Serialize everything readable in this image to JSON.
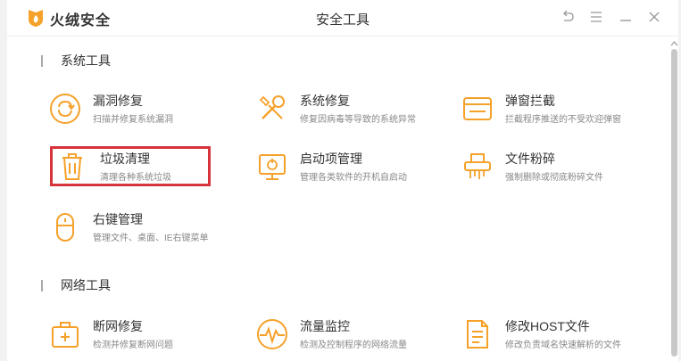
{
  "app": {
    "name": "火绒安全",
    "window_title": "安全工具"
  },
  "colors": {
    "accent": "#f5a12a",
    "highlight": "#d6343a"
  },
  "sections": [
    {
      "title": "系统工具",
      "tools": [
        {
          "name": "漏洞修复",
          "desc": "扫描并修复系统漏洞",
          "icon": "refresh-circle-icon"
        },
        {
          "name": "系统修复",
          "desc": "修复因病毒等导致的系统异常",
          "icon": "wrench-screwdriver-icon"
        },
        {
          "name": "弹窗拦截",
          "desc": "拦截程序推送的不受欢迎弹窗",
          "icon": "popup-window-icon"
        },
        {
          "name": "垃圾清理",
          "desc": "清理各种系统垃圾",
          "icon": "trash-icon"
        },
        {
          "name": "启动项管理",
          "desc": "管理各类软件的开机自启动",
          "icon": "monitor-power-icon"
        },
        {
          "name": "文件粉碎",
          "desc": "强制删除或彻底粉碎文件",
          "icon": "shredder-icon"
        },
        {
          "name": "右键管理",
          "desc": "管理文件、桌面、IE右键菜单",
          "icon": "mouse-icon"
        }
      ]
    },
    {
      "title": "网络工具",
      "tools": [
        {
          "name": "断网修复",
          "desc": "检测并修复断网问题",
          "icon": "first-aid-kit-icon"
        },
        {
          "name": "流量监控",
          "desc": "检测及控制程序的网络流量",
          "icon": "pulse-monitor-icon"
        },
        {
          "name": "修改HOST文件",
          "desc": "修改负责域名快速解析的文件",
          "icon": "document-icon"
        }
      ]
    }
  ]
}
